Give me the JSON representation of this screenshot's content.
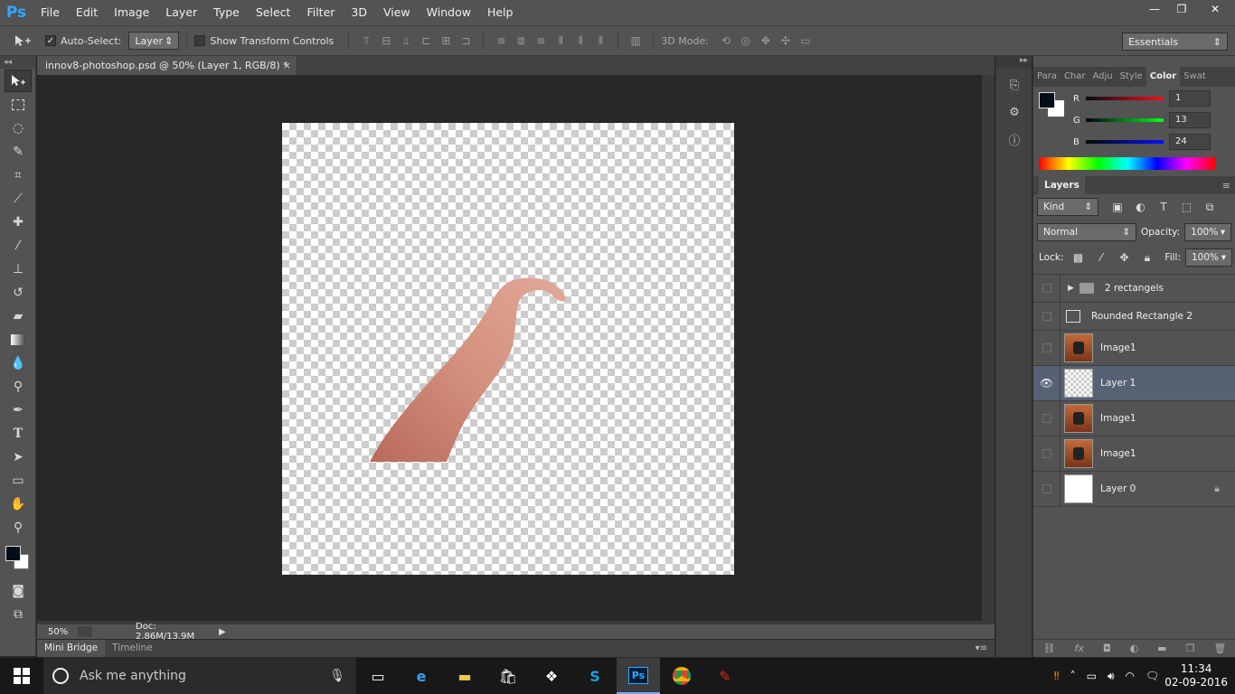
{
  "menubar": {
    "logo": "Ps",
    "items": [
      "File",
      "Edit",
      "Image",
      "Layer",
      "Type",
      "Select",
      "Filter",
      "3D",
      "View",
      "Window",
      "Help"
    ]
  },
  "window_controls": {
    "minimize": "—",
    "restore": "❐",
    "close": "✕"
  },
  "options": {
    "auto_select_label": "Auto-Select:",
    "auto_select_checked": true,
    "auto_select_value": "Layer",
    "show_transform_label": "Show Transform Controls",
    "show_transform_checked": false,
    "three_d_mode_label": "3D Mode:",
    "workspace": "Essentials"
  },
  "document": {
    "tab_title": "innov8-photoshop.psd @ 50% (Layer 1, RGB/8) *",
    "zoom": "50%",
    "doc_size": "Doc: 2.86M/13.9M"
  },
  "bottom_tabs": [
    "Mini Bridge",
    "Timeline"
  ],
  "color_panel": {
    "tabs": [
      "Para",
      "Char",
      "Adju",
      "Style",
      "Color",
      "Swat"
    ],
    "active_tab": "Color",
    "r_label": "R",
    "r_value": "1",
    "g_label": "G",
    "g_value": "13",
    "b_label": "B",
    "b_value": "24",
    "foreground": "#010d18",
    "background": "#ffffff"
  },
  "layers_panel": {
    "title": "Layers",
    "filter_kind": "Kind",
    "blend_mode": "Normal",
    "opacity_label": "Opacity:",
    "opacity_value": "100%",
    "lock_label": "Lock:",
    "fill_label": "Fill:",
    "fill_value": "100%",
    "layers": [
      {
        "name": "2 rectangels",
        "kind": "group",
        "visible": false,
        "selected": false
      },
      {
        "name": "Rounded Rectangle 2",
        "kind": "shape",
        "visible": false,
        "selected": false
      },
      {
        "name": "Image1",
        "kind": "photo",
        "visible": false,
        "selected": false
      },
      {
        "name": "Layer 1",
        "kind": "pixel",
        "visible": true,
        "selected": true
      },
      {
        "name": "Image1",
        "kind": "photo",
        "visible": false,
        "selected": false
      },
      {
        "name": "Image1",
        "kind": "photo",
        "visible": false,
        "selected": false
      },
      {
        "name": "Layer 0",
        "kind": "background",
        "visible": false,
        "selected": false,
        "locked": true
      }
    ]
  },
  "taskbar": {
    "search_placeholder": "Ask me anything",
    "time": "11:34",
    "date": "02-09-2016"
  }
}
